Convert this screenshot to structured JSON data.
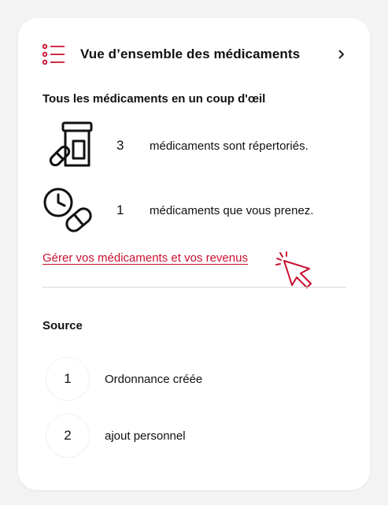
{
  "header": {
    "title": "Vue d’ensemble des médicaments",
    "icon": "list-icon",
    "chevron": "chevron-right-icon"
  },
  "glance": {
    "title": "Tous les médicaments en un coup d'œil",
    "stats": [
      {
        "icon": "pill-bottle-icon",
        "count": "3",
        "text": "médicaments sont répertoriés."
      },
      {
        "icon": "clock-pill-icon",
        "count": "1",
        "text": "médicaments que vous prenez."
      }
    ],
    "manage_link": "Gérer vos médicaments et vos revenus"
  },
  "source": {
    "title": "Source",
    "items": [
      {
        "number": "1",
        "label": "Ordonnance créée"
      },
      {
        "number": "2",
        "label": "ajout personnel"
      }
    ]
  },
  "colors": {
    "accent": "#c8102e",
    "text": "#111111",
    "divider": "#d9d9d9",
    "background": "#f3f3f3",
    "card": "#ffffff"
  }
}
